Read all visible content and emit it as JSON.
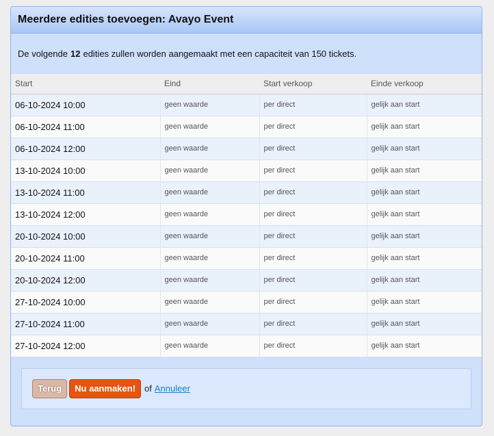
{
  "header": {
    "title": "Meerdere edities toevoegen: Avayo Event"
  },
  "intro": {
    "prefix": "De volgende",
    "count": "12",
    "suffix": "edities zullen worden aangemaakt met een capaciteit van 150 tickets."
  },
  "table": {
    "columns": [
      "Start",
      "Eind",
      "Start verkoop",
      "Einde verkoop"
    ],
    "rows": [
      [
        "06-10-2024 10:00",
        "geen waarde",
        "per direct",
        "gelijk aan start"
      ],
      [
        "06-10-2024 11:00",
        "geen waarde",
        "per direct",
        "gelijk aan start"
      ],
      [
        "06-10-2024 12:00",
        "geen waarde",
        "per direct",
        "gelijk aan start"
      ],
      [
        "13-10-2024 10:00",
        "geen waarde",
        "per direct",
        "gelijk aan start"
      ],
      [
        "13-10-2024 11:00",
        "geen waarde",
        "per direct",
        "gelijk aan start"
      ],
      [
        "13-10-2024 12:00",
        "geen waarde",
        "per direct",
        "gelijk aan start"
      ],
      [
        "20-10-2024 10:00",
        "geen waarde",
        "per direct",
        "gelijk aan start"
      ],
      [
        "20-10-2024 11:00",
        "geen waarde",
        "per direct",
        "gelijk aan start"
      ],
      [
        "20-10-2024 12:00",
        "geen waarde",
        "per direct",
        "gelijk aan start"
      ],
      [
        "27-10-2024 10:00",
        "geen waarde",
        "per direct",
        "gelijk aan start"
      ],
      [
        "27-10-2024 11:00",
        "geen waarde",
        "per direct",
        "gelijk aan start"
      ],
      [
        "27-10-2024 12:00",
        "geen waarde",
        "per direct",
        "gelijk aan start"
      ]
    ]
  },
  "actions": {
    "back_label": "Terug",
    "create_label": "Nu aanmaken!",
    "separator": "of",
    "cancel_label": "Annuleer"
  },
  "colors": {
    "header_gradient_top": "#d6e5fc",
    "header_gradient_bottom": "#a9c7f5",
    "create_button": "#e55410",
    "back_button": "#d9b8a6",
    "link": "#1a7fc4"
  }
}
